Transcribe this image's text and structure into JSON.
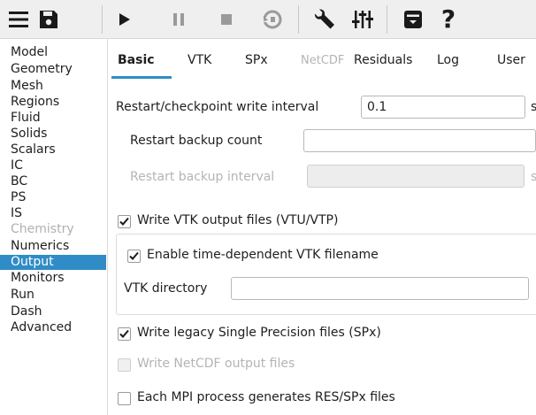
{
  "colors": {
    "accent": "#308cc6",
    "disabled_text": "#b4b4b4",
    "toolbar_bg": "#efefef"
  },
  "toolbar": {
    "icons": [
      "menu-icon",
      "save-icon",
      "play-icon",
      "pause-icon",
      "stop-icon",
      "reset-icon",
      "wrench-icon",
      "sliders-icon",
      "archive-icon",
      "help-icon"
    ]
  },
  "sidebar": {
    "items": [
      {
        "label": "Model",
        "state": "normal"
      },
      {
        "label": "Geometry",
        "state": "normal"
      },
      {
        "label": "Mesh",
        "state": "normal"
      },
      {
        "label": "Regions",
        "state": "normal"
      },
      {
        "label": "Fluid",
        "state": "normal"
      },
      {
        "label": "Solids",
        "state": "normal"
      },
      {
        "label": "Scalars",
        "state": "normal"
      },
      {
        "label": "IC",
        "state": "normal"
      },
      {
        "label": "BC",
        "state": "normal"
      },
      {
        "label": "PS",
        "state": "normal"
      },
      {
        "label": "IS",
        "state": "normal"
      },
      {
        "label": "Chemistry",
        "state": "disabled"
      },
      {
        "label": "Numerics",
        "state": "normal"
      },
      {
        "label": "Output",
        "state": "selected"
      },
      {
        "label": "Monitors",
        "state": "normal"
      },
      {
        "label": "Run",
        "state": "normal"
      },
      {
        "label": "Dash",
        "state": "normal"
      },
      {
        "label": "Advanced",
        "state": "normal"
      }
    ]
  },
  "tabs": [
    {
      "label": "Basic",
      "state": "active"
    },
    {
      "label": "VTK",
      "state": "normal"
    },
    {
      "label": "SPx",
      "state": "normal"
    },
    {
      "label": "NetCDF",
      "state": "disabled"
    },
    {
      "label": "Residuals",
      "state": "normal"
    },
    {
      "label": "Log",
      "state": "normal"
    },
    {
      "label": "User",
      "state": "normal"
    }
  ],
  "basic": {
    "restart_interval_label": "Restart/checkpoint write interval",
    "restart_interval_value": "0.1",
    "restart_interval_unit": "s",
    "backup_count_label": "Restart backup count",
    "backup_count_value": "",
    "backup_interval_label": "Restart backup interval",
    "backup_interval_value": "",
    "backup_interval_unit": "s",
    "write_vtk_label": "Write VTK output files (VTU/VTP)",
    "write_vtk_checked": true,
    "time_dep_vtk_label": "Enable time-dependent VTK filename",
    "time_dep_vtk_checked": true,
    "vtk_dir_label": "VTK directory",
    "vtk_dir_value": "",
    "write_spx_label": "Write legacy Single Precision files (SPx)",
    "write_spx_checked": true,
    "write_netcdf_label": "Write NetCDF output files",
    "write_netcdf_checked": false,
    "mpi_res_label": "Each MPI process generates RES/SPx files",
    "mpi_res_checked": false
  }
}
